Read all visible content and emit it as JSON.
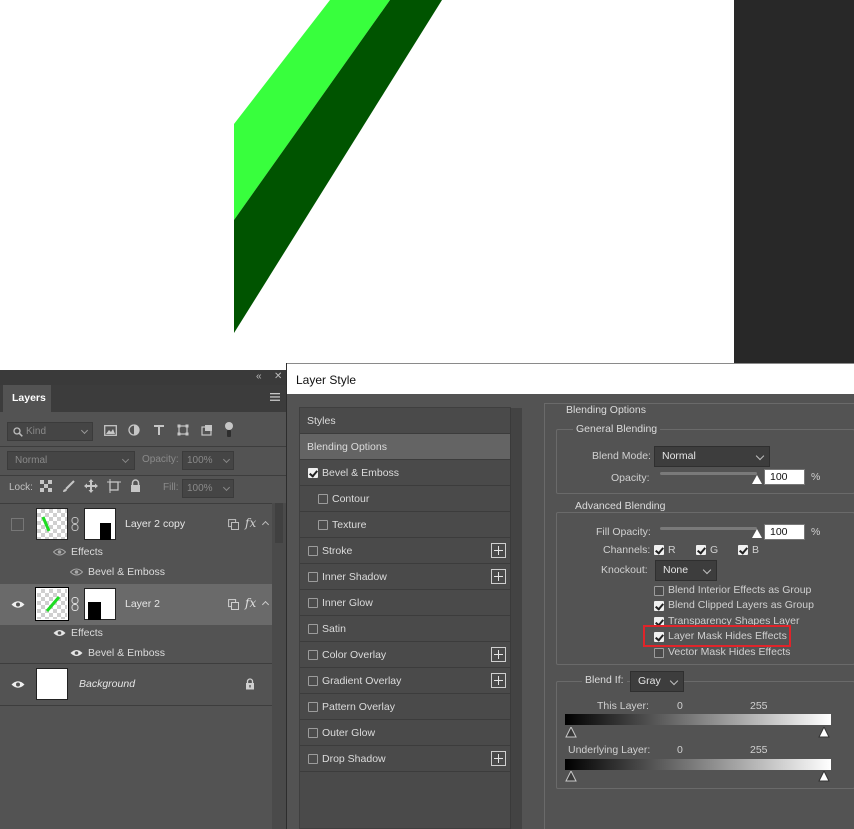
{
  "canvas": {
    "shape_colors": {
      "bright": "#38ff3d",
      "dark": "#005400"
    }
  },
  "layers_panel": {
    "tab": "Layers",
    "top_buttons": [
      "«",
      "✕"
    ],
    "filter": {
      "kind_label": "Kind"
    },
    "blend_mode": "Normal",
    "opacity_label": "Opacity:",
    "opacity_value": "100%",
    "lock_label": "Lock:",
    "fill_label": "Fill:",
    "fill_value": "100%",
    "layers": [
      {
        "name": "Layer 2 copy",
        "visible": false,
        "selected": false,
        "effects_label": "Effects",
        "effect": "Bevel & Emboss"
      },
      {
        "name": "Layer 2",
        "visible": true,
        "selected": true,
        "effects_label": "Effects",
        "effect": "Bevel & Emboss"
      },
      {
        "name": "Background",
        "visible": true,
        "locked": true
      }
    ],
    "fx_label": "fx"
  },
  "dialog": {
    "title": "Layer Style",
    "styles": [
      {
        "label": "Styles",
        "checkbox": false,
        "plus": false
      },
      {
        "label": "Blending Options",
        "checkbox": false,
        "plus": false,
        "selected": true
      },
      {
        "label": "Bevel & Emboss",
        "checkbox": true,
        "checked": true,
        "plus": false
      },
      {
        "label": "Contour",
        "checkbox": true,
        "checked": false,
        "indent": true
      },
      {
        "label": "Texture",
        "checkbox": true,
        "checked": false,
        "indent": true
      },
      {
        "label": "Stroke",
        "checkbox": true,
        "checked": false,
        "plus": true
      },
      {
        "label": "Inner Shadow",
        "checkbox": true,
        "checked": false,
        "plus": true
      },
      {
        "label": "Inner Glow",
        "checkbox": true,
        "checked": false,
        "plus": false
      },
      {
        "label": "Satin",
        "checkbox": true,
        "checked": false,
        "plus": false
      },
      {
        "label": "Color Overlay",
        "checkbox": true,
        "checked": false,
        "plus": true
      },
      {
        "label": "Gradient Overlay",
        "checkbox": true,
        "checked": false,
        "plus": true
      },
      {
        "label": "Pattern Overlay",
        "checkbox": true,
        "checked": false,
        "plus": false
      },
      {
        "label": "Outer Glow",
        "checkbox": true,
        "checked": false,
        "plus": false
      },
      {
        "label": "Drop Shadow",
        "checkbox": true,
        "checked": false,
        "plus": true
      }
    ],
    "blending_options": {
      "section_title": "Blending Options",
      "general": {
        "title": "General Blending",
        "blend_mode_label": "Blend Mode:",
        "blend_mode_value": "Normal",
        "opacity_label": "Opacity:",
        "opacity_value": "100",
        "opacity_fraction": 1.0,
        "percent": "%"
      },
      "advanced": {
        "title": "Advanced Blending",
        "fill_opacity_label": "Fill Opacity:",
        "fill_opacity_value": "100",
        "fill_opacity_fraction": 1.0,
        "percent": "%",
        "channels_label": "Channels:",
        "channels": [
          {
            "label": "R",
            "checked": true
          },
          {
            "label": "G",
            "checked": true
          },
          {
            "label": "B",
            "checked": true
          }
        ],
        "knockout_label": "Knockout:",
        "knockout_value": "None",
        "options": [
          {
            "label": "Blend Interior Effects as Group",
            "checked": false
          },
          {
            "label": "Blend Clipped Layers as Group",
            "checked": true
          },
          {
            "label": "Transparency Shapes Layer",
            "checked": true
          },
          {
            "label": "Layer Mask Hides Effects",
            "checked": true,
            "highlighted": true
          },
          {
            "label": "Vector Mask Hides Effects",
            "checked": false
          }
        ]
      },
      "blend_if": {
        "label": "Blend If:",
        "value": "Gray",
        "this_layer_label": "This Layer:",
        "this_layer_low": "0",
        "this_layer_high": "255",
        "underlying_label": "Underlying Layer:",
        "underlying_low": "0",
        "underlying_high": "255"
      }
    },
    "highlight_color": "#e0242a"
  }
}
